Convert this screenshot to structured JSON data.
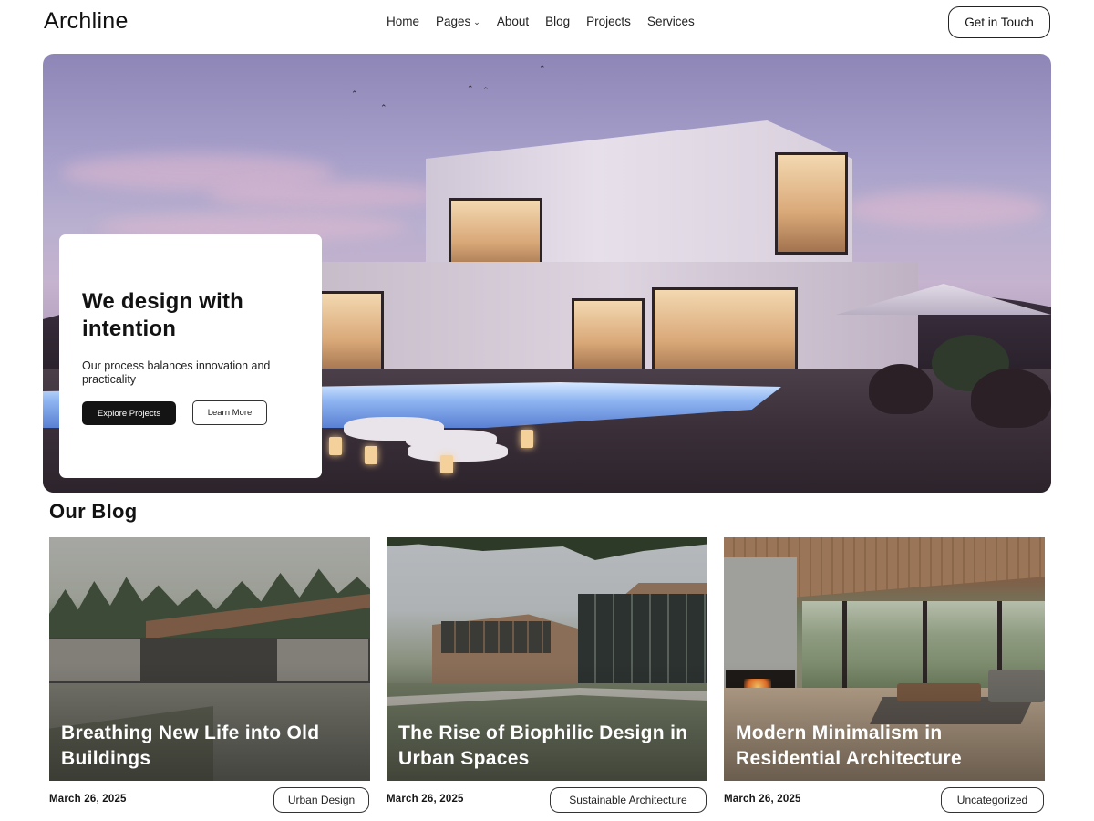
{
  "header": {
    "logo": "Archline",
    "nav": [
      {
        "label": "Home",
        "has_dropdown": false
      },
      {
        "label": "Pages",
        "has_dropdown": true
      },
      {
        "label": "About",
        "has_dropdown": false
      },
      {
        "label": "Blog",
        "has_dropdown": false
      },
      {
        "label": "Projects",
        "has_dropdown": false
      },
      {
        "label": "Services",
        "has_dropdown": false
      }
    ],
    "cta_label": "Get in Touch",
    "dropdown_icon": "chevron-down-icon"
  },
  "hero": {
    "title": "We design with intention",
    "subtitle": "Our process balances innovation and practicality",
    "primary_button": "Explore Projects",
    "secondary_button": "Learn More"
  },
  "blog": {
    "heading": "Our Blog",
    "posts": [
      {
        "title": "Breathing New Life into Old Buildings",
        "date": "March 26, 2025",
        "category": "Urban Design"
      },
      {
        "title": "The Rise of Biophilic Design in Urban Spaces",
        "date": "March 26, 2025",
        "category": "Sustainable Architecture"
      },
      {
        "title": "Modern Minimalism in Residential Architecture",
        "date": "March 26, 2025",
        "category": "Uncategorized"
      }
    ]
  },
  "colors": {
    "text": "#121212",
    "primary_button_bg": "#141414",
    "background": "#ffffff"
  }
}
